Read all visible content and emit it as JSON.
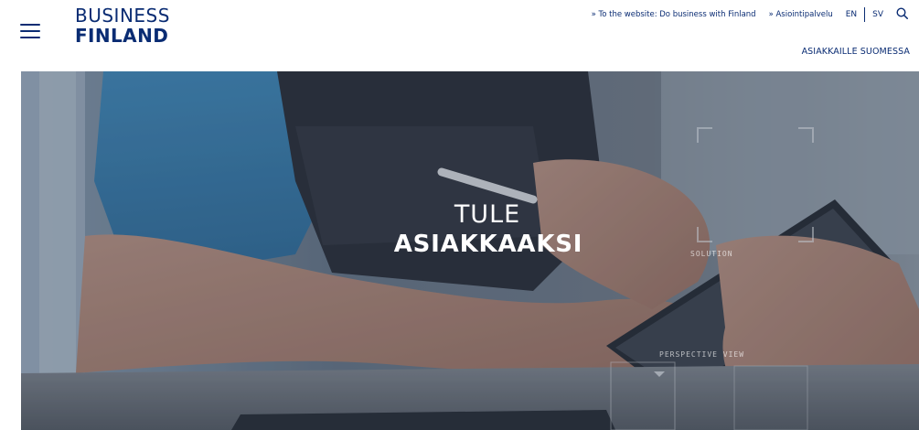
{
  "header": {
    "logo": {
      "line1": "BUSINESS",
      "line2": "FINLAND"
    },
    "links": {
      "website": "» To the website: Do business with Finland",
      "service": "» Asiointipalvelu",
      "lang_en": "EN",
      "lang_sv": "SV"
    },
    "secondary_link": "ASIAKKAILLE SUOMESSA",
    "icons": {
      "menu": "hamburger-menu-icon",
      "search": "search-icon"
    }
  },
  "hero": {
    "title_line1": "TULE",
    "title_line2": "ASIAKKAAKSI",
    "overlay_text": {
      "solution": "SOLUTION",
      "perspective": "PERSPECTIVE VIEW"
    }
  },
  "colors": {
    "brand": "#0a2c73",
    "hero_text": "#ffffff"
  }
}
